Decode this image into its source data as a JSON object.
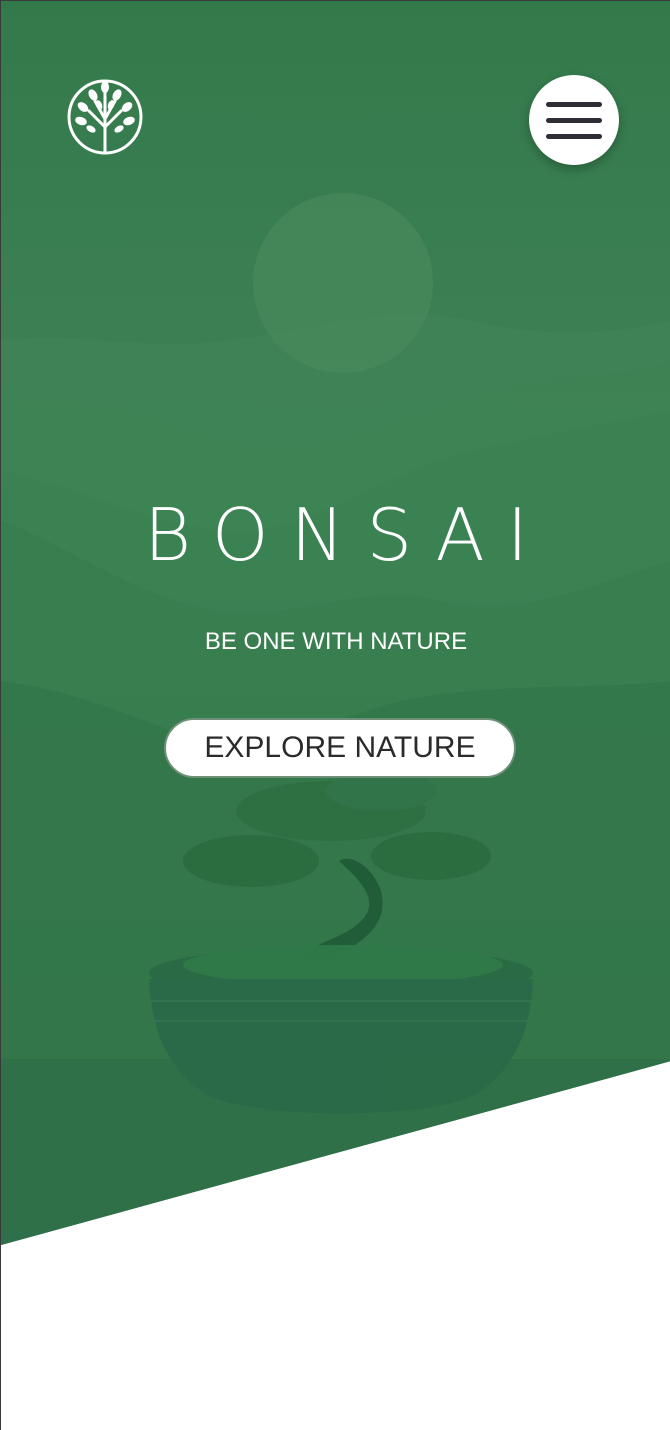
{
  "brand": {
    "logo_icon": "tree-of-life-icon"
  },
  "nav": {
    "menu_icon": "hamburger-menu-icon"
  },
  "hero": {
    "title": "BONSAI",
    "subtitle": "BE ONE WITH NATURE",
    "cta_label": "EXPLORE NATURE"
  },
  "colors": {
    "hero_green": "#337a4a",
    "text_light": "#ffffff",
    "menu_bar": "#2e2e36",
    "background": "#ffffff"
  }
}
